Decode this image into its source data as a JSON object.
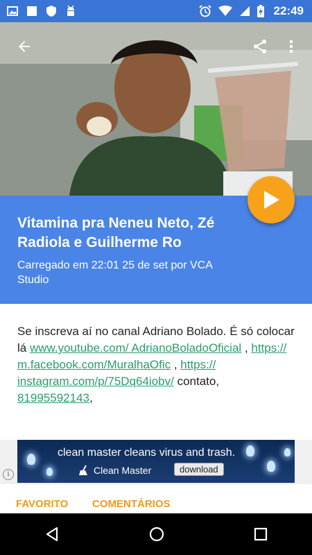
{
  "status_bar": {
    "time": "22:49",
    "left_icons": [
      "image-icon",
      "square-icon",
      "shield-icon",
      "android-icon"
    ],
    "right_icons": [
      "alarm-icon",
      "wifi-icon",
      "signal-icon",
      "battery-charging-icon"
    ]
  },
  "video": {
    "back_icon": "arrow-back-icon",
    "share_icon": "share-icon",
    "more_icon": "more-vert-icon"
  },
  "header": {
    "title": "Vitamina pra Neneu Neto, Zé Radiola e Guilherme Ro",
    "subtitle": "Carregado em 22:01 25 de set por VCA Studio",
    "play_icon": "play-icon",
    "accent": "#4a84e6",
    "play_color": "#f7a21a"
  },
  "description": {
    "text1": "Se inscreva aí no canal Adriano Bolado. É só colocar lá ",
    "link1": "www.youtube.com/ AdrianoBoladoOficial",
    "text2": " ,  ",
    "link2": "https:// m.facebook.com/MuralhaOfic",
    "text3": " , ",
    "link3": "https:// instagram.com/p/75Dq64iobv/",
    "text4": " contato, ",
    "link4": "81995592143",
    "text5": ","
  },
  "ad": {
    "headline": "clean master cleans virus and trash.",
    "brand": "Clean Master",
    "download_label": "download",
    "info_label": "i"
  },
  "tabs": [
    {
      "label": "FAVORITO"
    },
    {
      "label": "COMENTÁRIOS"
    }
  ],
  "nav": {
    "back_icon": "nav-back-icon",
    "home_icon": "nav-home-icon",
    "recents_icon": "nav-recents-icon"
  }
}
